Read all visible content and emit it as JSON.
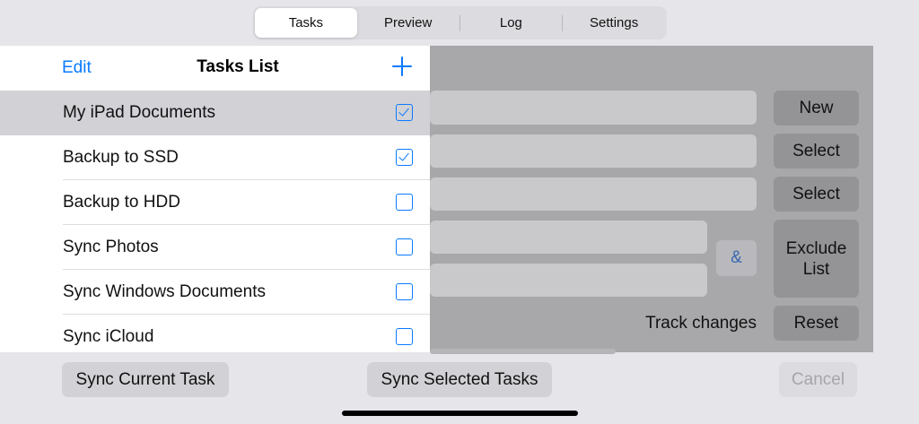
{
  "tabs": [
    {
      "label": "Tasks",
      "active": true
    },
    {
      "label": "Preview",
      "active": false
    },
    {
      "label": "Log",
      "active": false
    },
    {
      "label": "Settings",
      "active": false
    }
  ],
  "popover": {
    "edit_label": "Edit",
    "title": "Tasks List",
    "add_icon": "plus-icon",
    "items": [
      {
        "label": "My iPad Documents",
        "checked": true,
        "selected": true
      },
      {
        "label": "Backup to SSD",
        "checked": true,
        "selected": false
      },
      {
        "label": "Backup to HDD",
        "checked": false,
        "selected": false
      },
      {
        "label": "Sync Photos",
        "checked": false,
        "selected": false
      },
      {
        "label": "Sync Windows Documents",
        "checked": false,
        "selected": false
      },
      {
        "label": "Sync iCloud",
        "checked": false,
        "selected": false
      }
    ]
  },
  "main": {
    "new_label": "New",
    "select_label_1": "Select",
    "select_label_2": "Select",
    "amp_label": "&",
    "exclude_label": "Exclude List",
    "track_label": "Track changes",
    "reset_label": "Reset"
  },
  "toolbar": {
    "sync_current_label": "Sync Current Task",
    "sync_selected_label": "Sync Selected Tasks",
    "cancel_label": "Cancel",
    "cancel_enabled": false
  },
  "colors": {
    "accent": "#0a7aff",
    "background": "#e6e6ea",
    "dim_panel": "#a8a8ab"
  }
}
